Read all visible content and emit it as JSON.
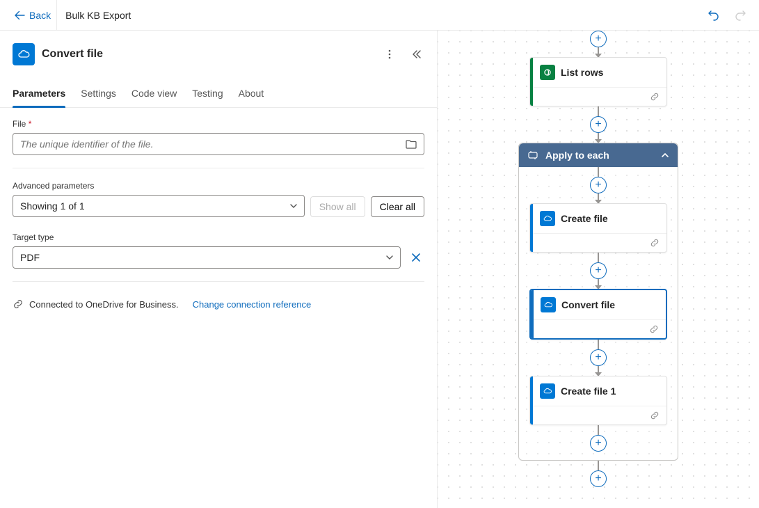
{
  "header": {
    "back": "Back",
    "title": "Bulk KB Export"
  },
  "pane": {
    "step_title": "Convert file",
    "tabs": {
      "parameters": "Parameters",
      "settings": "Settings",
      "codeview": "Code view",
      "testing": "Testing",
      "about": "About"
    },
    "file_label": "File",
    "file_placeholder": "The unique identifier of the file.",
    "advanced_label": "Advanced parameters",
    "advanced_value": "Showing 1 of 1",
    "show_all": "Show all",
    "clear_all": "Clear all",
    "target_type_label": "Target type",
    "target_type_value": "PDF",
    "connected_text": "Connected to OneDrive for Business.",
    "change_conn": "Change connection reference"
  },
  "flow": {
    "list_rows": "List rows",
    "apply_each": "Apply to each",
    "create_file": "Create file",
    "convert_file": "Convert file",
    "create_file1": "Create file 1"
  }
}
